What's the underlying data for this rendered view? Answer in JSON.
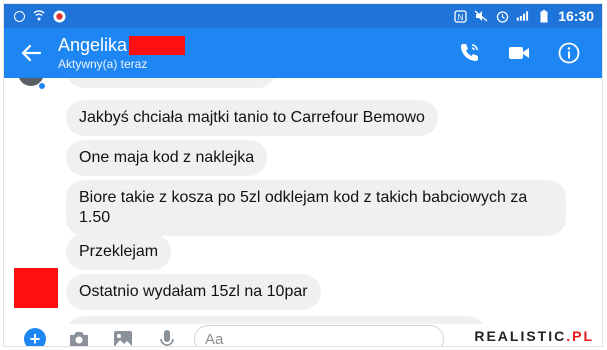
{
  "statusbar": {
    "time": "16:30",
    "left_icons": [
      "messenger-notification-icon",
      "wifi-hotspot-icon",
      "app-notification-icon"
    ],
    "right_icons": [
      "nfc-icon",
      "mute-icon",
      "alarm-icon",
      "signal-icon",
      "battery-icon"
    ]
  },
  "header": {
    "name": "Angelika",
    "status": "Aktywny(a) teraz",
    "accent_color": "#1e86f3"
  },
  "messages": [
    {
      "text": "Jakbyś chciała majtki tanio to Carrefour Bemowo"
    },
    {
      "text": "One maja kod z naklejka"
    },
    {
      "text": "Biore takie z kosza po 5zl odklejam kod z takich babciowych za 1.50"
    },
    {
      "text": "Przeklejam"
    },
    {
      "text": "Ostatnio wydałam 15zl na 10par"
    }
  ],
  "composer": {
    "placeholder": "Aa"
  },
  "watermark": {
    "part1": "REALISTIC",
    "part2": ".PL"
  }
}
